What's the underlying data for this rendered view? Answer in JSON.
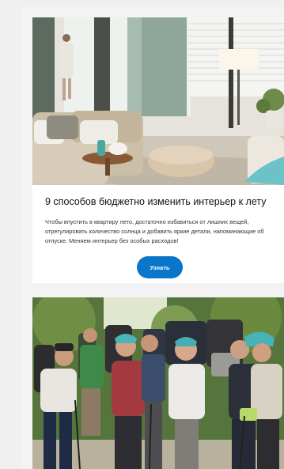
{
  "articles": [
    {
      "image": "living-room-interior-photo",
      "title": "9 способов бюджетно изменить интерьер к лету",
      "description": "Чтобы впустить в квартиру лето, достаточно избавиться от лишних вещей, отрегулировать количество солнца и добавить яркие детали, напоминающие об отпуске. Меняем интерьер без особых расходов!",
      "button_label": "Узнать"
    },
    {
      "image": "hikers-in-forest-photo"
    }
  ],
  "colors": {
    "accent": "#0a76c9",
    "card": "#ffffff",
    "background": "#f0f0f0"
  }
}
